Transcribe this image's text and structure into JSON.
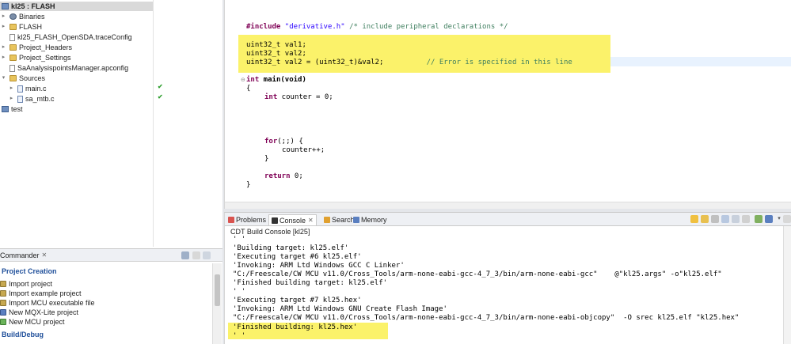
{
  "explorer": {
    "project_label": "kl25 : FLASH",
    "items": [
      {
        "label": "Binaries"
      },
      {
        "label": "FLASH"
      },
      {
        "label": "kl25_FLASH_OpenSDA.traceConfig"
      },
      {
        "label": "Project_Headers"
      },
      {
        "label": "Project_Settings"
      },
      {
        "label": "SaAnalysispointsManager.apconfig"
      },
      {
        "label": "Sources"
      },
      {
        "label": "main.c"
      },
      {
        "label": "sa_mtb.c"
      },
      {
        "label": "test"
      }
    ]
  },
  "editor": {
    "include_kw": "#include",
    "include_file": "\"derivative.h\"",
    "include_comment": "/* include peripheral declarations */",
    "decl1": "uint32_t val1;",
    "decl2": "uint32_t val2;",
    "decl3": "uint32_t val2 = (uint32_t)&val2;",
    "decl3_comment": "// Error is specified in this line",
    "main_kw": "int",
    "main_sig": " main(void)",
    "open_brace": "{",
    "counter_kw": "int",
    "counter_decl": " counter = 0;",
    "for_kw": "for",
    "for_rest": "(;;) {",
    "counter_inc": "counter++;",
    "inner_close": "}",
    "return_kw": "return",
    "return_rest": " 0;",
    "close_brace": "}"
  },
  "console": {
    "tabs": [
      {
        "label": "Problems"
      },
      {
        "label": "Console"
      },
      {
        "label": "Search"
      },
      {
        "label": "Memory"
      }
    ],
    "title": "CDT Build Console [kl25]",
    "lines": [
      "' '",
      "'Building target: kl25.elf'",
      "'Executing target #6 kl25.elf'",
      "'Invoking: ARM Ltd Windows GCC C Linker'",
      "\"C:/Freescale/CW MCU v11.0/Cross_Tools/arm-none-eabi-gcc-4_7_3/bin/arm-none-eabi-gcc\"    @\"kl25.args\" -o\"kl25.elf\"",
      "'Finished building target: kl25.elf'",
      "' '",
      "'Executing target #7 kl25.hex'",
      "'Invoking: ARM Ltd Windows GNU Create Flash Image'",
      "\"C:/Freescale/CW MCU v11.0/Cross_Tools/arm-none-eabi-gcc-4_7_3/bin/arm-none-eabi-objcopy\"  -O srec kl25.elf \"kl25.hex\"",
      "'Finished building: kl25.hex'",
      "' '"
    ]
  },
  "commander": {
    "title": "Commander",
    "project_creation": "Project Creation",
    "items": [
      {
        "label": "Import project"
      },
      {
        "label": "Import example project"
      },
      {
        "label": "Import MCU executable file"
      },
      {
        "label": "New MQX-Lite project"
      },
      {
        "label": "New MCU project"
      }
    ],
    "build_debug": "Build/Debug"
  },
  "colors": {
    "highlight": "#fbf26a",
    "keyword": "#7f0055",
    "string": "#2a00ff",
    "comment": "#3f7f5f",
    "section_header": "#1f4f9a"
  }
}
